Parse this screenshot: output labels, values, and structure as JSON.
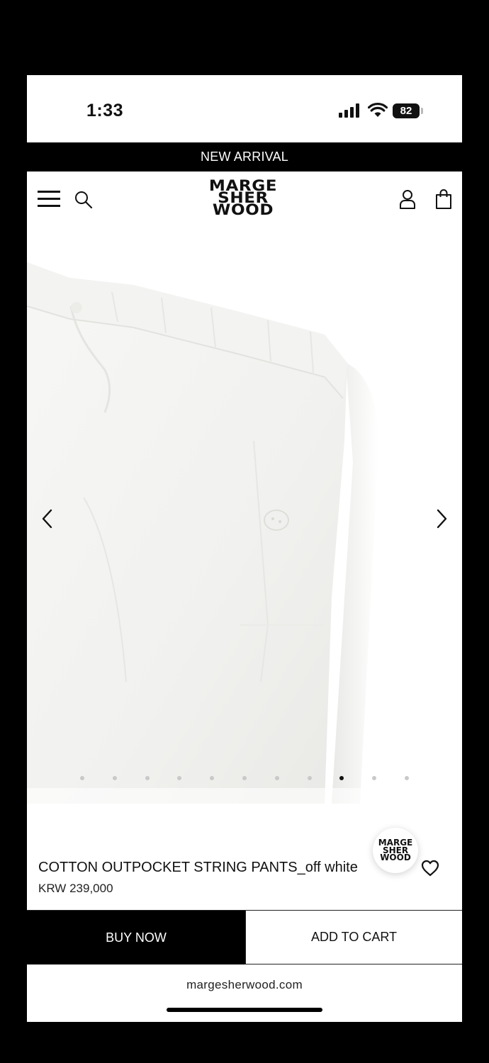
{
  "status_bar": {
    "time": "1:33",
    "battery": "82",
    "icons": [
      "signal-icon",
      "wifi-icon",
      "battery-icon"
    ]
  },
  "announcement": "NEW ARRIVAL",
  "header": {
    "logo_lines": [
      "MARGE",
      "SHER",
      "WOOD"
    ],
    "icons": [
      "menu-icon",
      "search-icon",
      "account-icon",
      "cart-icon"
    ]
  },
  "gallery": {
    "image": "off white cotton pants",
    "total_slides": 11,
    "active_slide": 9,
    "icons": [
      "chevron-left-icon",
      "chevron-right-icon"
    ]
  },
  "product": {
    "name": "COTTON OUTPOCKET STRING PANTS_off white",
    "price": "KRW 239,000",
    "badge_lines": [
      "MARGE",
      "SHER",
      "WOOD"
    ],
    "wishlist_icon": "heart-icon"
  },
  "actions": {
    "buy_now": "BUY NOW",
    "add_to_cart": "ADD TO CART"
  },
  "browser": {
    "url": "margesherwood.com"
  }
}
